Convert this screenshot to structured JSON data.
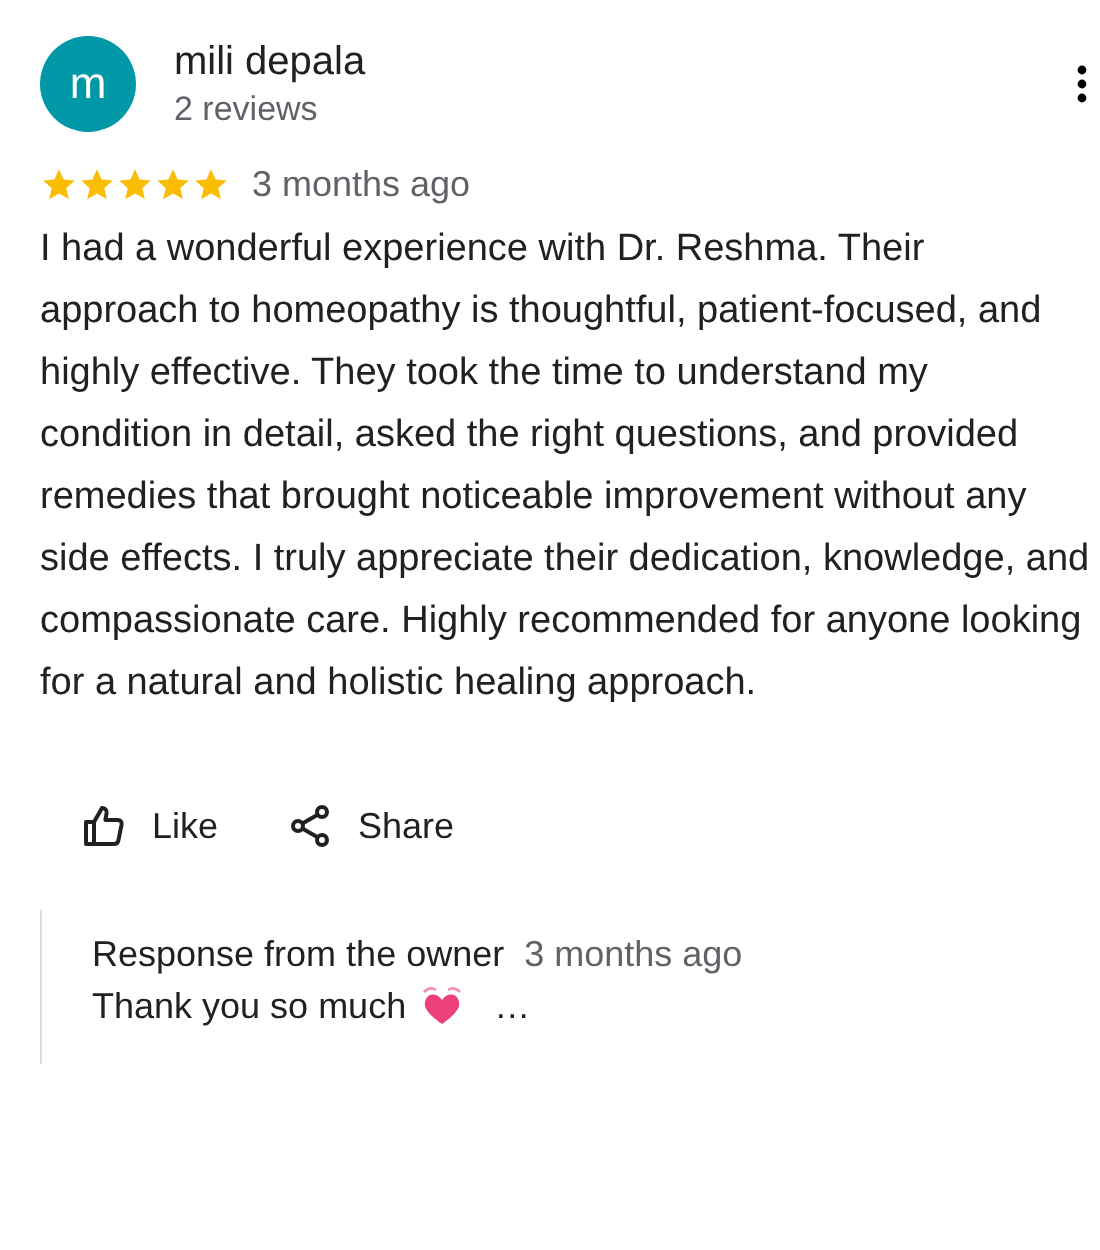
{
  "review": {
    "avatar_letter": "m",
    "author": "mili depala",
    "review_count": "2 reviews",
    "stars": 5,
    "time": "3 months ago",
    "text": "I had a wonderful experience with Dr. Reshma. Their approach to homeopathy is thoughtful, patient-focused, and highly effective. They took the time to understand my condition in detail, asked the right questions, and provided remedies that brought noticeable improvement without any side effects. I truly appreciate their dedication, knowledge, and compassionate care. Highly recommended for anyone looking for a natural and holistic healing approach."
  },
  "actions": [
    {
      "kind": "like",
      "label": "Like"
    },
    {
      "kind": "share",
      "label": "Share"
    }
  ],
  "owner_response": {
    "title": "Response from the owner",
    "time": "3 months ago",
    "text": "Thank you so much",
    "more": "…"
  }
}
